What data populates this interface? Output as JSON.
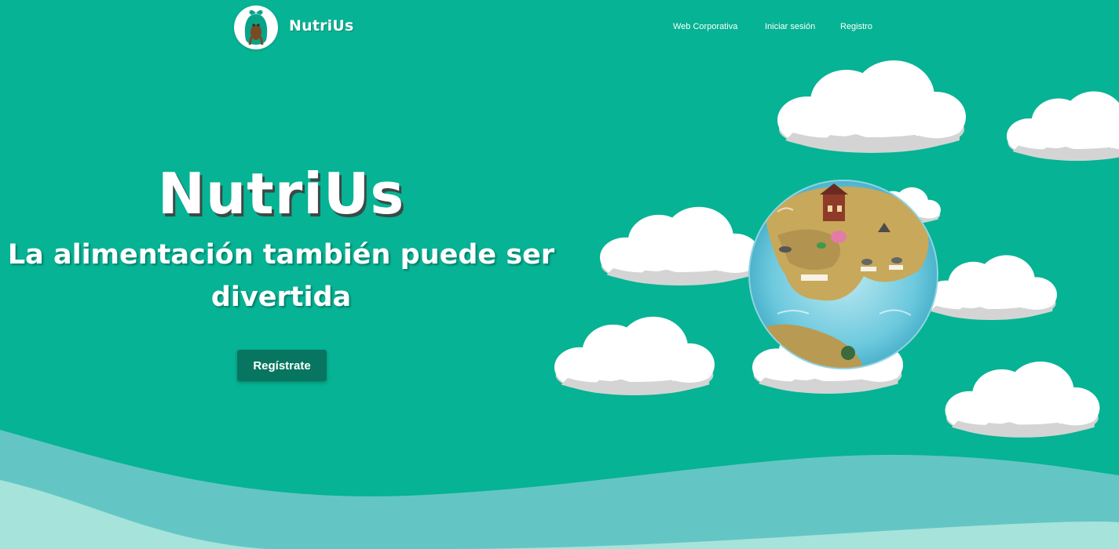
{
  "nav": {
    "brand": "NutriUs",
    "links": [
      "Web Corporativa",
      "Iniciar sesión",
      "Registro"
    ]
  },
  "hero": {
    "title": "NutriUs",
    "subtitle": "La alimentación también puede ser divertida",
    "cta_label": "Regístrate"
  },
  "colors": {
    "background": "#06b394",
    "button": "#07755f",
    "wave_mid": "#64c6c4",
    "wave_light": "#a6e3db",
    "cloud": "#ffffff",
    "cloud_shadow": "#d4d4d4"
  },
  "icons": {
    "logo": "avocado-mascot-icon",
    "globe": "island-globe-illustration"
  }
}
